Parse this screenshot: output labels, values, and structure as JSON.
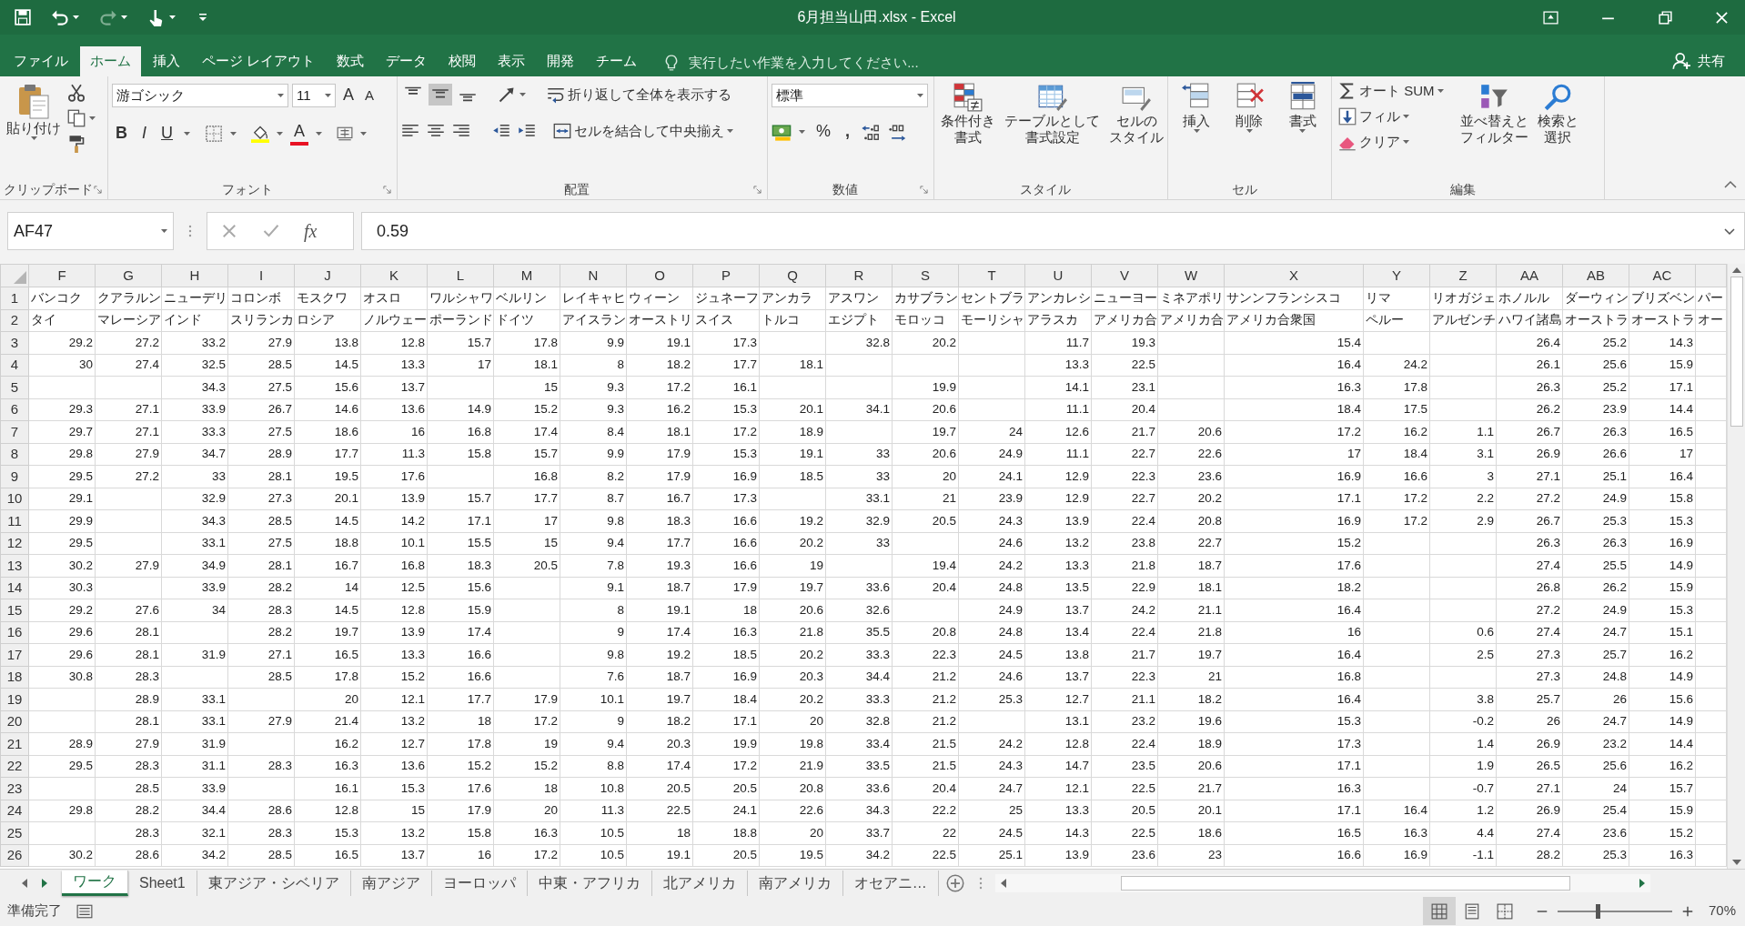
{
  "window": {
    "title": "6月担当山田.xlsx - Excel"
  },
  "ribbon": {
    "tabs": [
      {
        "label": "ファイル",
        "selected": false
      },
      {
        "label": "ホーム",
        "selected": true
      },
      {
        "label": "挿入",
        "selected": false
      },
      {
        "label": "ページ レイアウト",
        "selected": false
      },
      {
        "label": "数式",
        "selected": false
      },
      {
        "label": "データ",
        "selected": false
      },
      {
        "label": "校閲",
        "selected": false
      },
      {
        "label": "表示",
        "selected": false
      },
      {
        "label": "開発",
        "selected": false
      },
      {
        "label": "チーム",
        "selected": false
      }
    ],
    "tell_me": {
      "placeholder": "実行したい作業を入力してください..."
    },
    "share": "共有",
    "clipboard": {
      "paste": "貼り付け",
      "label": "クリップボード"
    },
    "font": {
      "name": "游ゴシック",
      "size": "11",
      "grow": "A",
      "shrink": "A",
      "bold": "B",
      "italic": "I",
      "underline": "U",
      "color_letter": "A",
      "label": "フォント"
    },
    "alignment": {
      "vertical": [
        {
          "selected": false
        },
        {
          "selected": true
        },
        {
          "selected": false
        }
      ],
      "wrap": "折り返して全体を表示する",
      "merge": "セルを結合して中央揃え",
      "label": "配置"
    },
    "number": {
      "format": "標準",
      "percent": "%",
      "comma": ",",
      "label": "数値"
    },
    "styles": {
      "buttons": [
        [
          "条件付き",
          "書式"
        ],
        [
          "テーブルとして",
          "書式設定"
        ],
        [
          "セルの",
          "スタイル"
        ]
      ],
      "label": "スタイル"
    },
    "cells": {
      "buttons": [
        "挿入",
        "削除",
        "書式"
      ],
      "label": "セル"
    },
    "editing": {
      "autosum": "オート SUM",
      "fill": "フィル",
      "clear": "クリア",
      "sort": [
        "並べ替えと",
        "フィルター"
      ],
      "find": [
        "検索と",
        "選択"
      ],
      "label": "編集"
    }
  },
  "formula_bar": {
    "name_box": "AF47",
    "fx": "fx",
    "value": "0.59"
  },
  "sheet": {
    "columns": [
      "F",
      "G",
      "H",
      "I",
      "J",
      "K",
      "L",
      "M",
      "N",
      "O",
      "P",
      "Q",
      "R",
      "S",
      "T",
      "U",
      "V",
      "W",
      "X",
      "Y",
      "Z",
      "AA",
      "AB",
      "AC"
    ],
    "rows": [
      {
        "number": "1",
        "kind": "labels",
        "cells": [
          "バンコク",
          "クアラルン",
          "ニューデリ",
          "コロンボ",
          "モスクワ",
          "オスロ",
          "ワルシャワ",
          "ベルリン",
          "レイキャヒ",
          "ウィーン",
          "ジュネーフ",
          "アンカラ",
          "アスワン",
          "カサブラン",
          "セントブラ",
          "アンカレシ",
          "ニューヨー",
          "ミネアポリ",
          "サンンフランシスコ",
          "リマ",
          "リオガジェ",
          "ホノルル",
          "ダーウィン",
          "ブリズベン",
          "パー"
        ]
      },
      {
        "number": "2",
        "kind": "labels",
        "cells": [
          "タイ",
          "マレーシア",
          "インド",
          "スリランカ",
          "ロシア",
          "ノルウェー",
          "ポーランド",
          "ドイツ",
          "アイスラン",
          "オーストリ",
          "スイス",
          "トルコ",
          "エジプト",
          "モロッコ",
          "モーリシャ",
          "アラスカ",
          "アメリカ合",
          "アメリカ合",
          "アメリカ合衆国",
          "ペルー",
          "アルゼンチ",
          "ハワイ諸島",
          "オーストラ",
          "オーストラ",
          "オー"
        ]
      },
      {
        "number": "3",
        "kind": "values",
        "cells": [
          "29.2",
          "27.2",
          "33.2",
          "27.9",
          "13.8",
          "12.8",
          "15.7",
          "17.8",
          "9.9",
          "19.1",
          "17.3",
          null,
          "32.8",
          "20.2",
          null,
          "11.7",
          "19.3",
          null,
          "15.4",
          null,
          null,
          "26.4",
          "25.2",
          "14.3"
        ]
      },
      {
        "number": "4",
        "kind": "values",
        "cells": [
          "30",
          "27.4",
          "32.5",
          "28.5",
          "14.5",
          "13.3",
          "17",
          "18.1",
          "8",
          "18.2",
          "17.7",
          "18.1",
          null,
          null,
          null,
          "13.3",
          "22.5",
          null,
          "16.4",
          "24.2",
          null,
          "26.1",
          "25.6",
          "15.9"
        ]
      },
      {
        "number": "5",
        "kind": "values",
        "cells": [
          null,
          null,
          "34.3",
          "27.5",
          "15.6",
          "13.7",
          null,
          "15",
          "9.3",
          "17.2",
          "16.1",
          null,
          null,
          "19.9",
          null,
          "14.1",
          "23.1",
          null,
          "16.3",
          "17.8",
          null,
          "26.3",
          "25.2",
          "17.1"
        ]
      },
      {
        "number": "6",
        "kind": "values",
        "cells": [
          "29.3",
          "27.1",
          "33.9",
          "26.7",
          "14.6",
          "13.6",
          "14.9",
          "15.2",
          "9.3",
          "16.2",
          "15.3",
          "20.1",
          "34.1",
          "20.6",
          null,
          "11.1",
          "20.4",
          null,
          "18.4",
          "17.5",
          null,
          "26.2",
          "23.9",
          "14.4"
        ]
      },
      {
        "number": "7",
        "kind": "values",
        "cells": [
          "29.7",
          "27.1",
          "33.3",
          "27.5",
          "18.6",
          "16",
          "16.8",
          "17.4",
          "8.4",
          "18.1",
          "17.2",
          "18.9",
          null,
          "19.7",
          "24",
          "12.6",
          "21.7",
          "20.6",
          "17.2",
          "16.2",
          "1.1",
          "26.7",
          "26.3",
          "16.5"
        ]
      },
      {
        "number": "8",
        "kind": "values",
        "cells": [
          "29.8",
          "27.9",
          "34.7",
          "28.9",
          "17.7",
          "11.3",
          "15.8",
          "15.7",
          "9.9",
          "17.9",
          "15.3",
          "19.1",
          "33",
          "20.6",
          "24.9",
          "11.1",
          "22.7",
          "22.6",
          "17",
          "18.4",
          "3.1",
          "26.9",
          "26.6",
          "17"
        ]
      },
      {
        "number": "9",
        "kind": "values",
        "cells": [
          "29.5",
          "27.2",
          "33",
          "28.1",
          "19.5",
          "17.6",
          null,
          "16.8",
          "8.2",
          "17.9",
          "16.9",
          "18.5",
          "33",
          "20",
          "24.1",
          "12.9",
          "22.3",
          "23.6",
          "16.9",
          "16.6",
          "3",
          "27.1",
          "25.1",
          "16.4"
        ]
      },
      {
        "number": "10",
        "kind": "values",
        "cells": [
          "29.1",
          null,
          "32.9",
          "27.3",
          "20.1",
          "13.9",
          "15.7",
          "17.7",
          "8.7",
          "16.7",
          "17.3",
          null,
          "33.1",
          "21",
          "23.9",
          "12.9",
          "22.7",
          "20.2",
          "17.1",
          "17.2",
          "2.2",
          "27.2",
          "24.9",
          "15.8"
        ]
      },
      {
        "number": "11",
        "kind": "values",
        "cells": [
          "29.9",
          null,
          "34.3",
          "28.5",
          "14.5",
          "14.2",
          "17.1",
          "17",
          "9.8",
          "18.3",
          "16.6",
          "19.2",
          "32.9",
          "20.5",
          "24.3",
          "13.9",
          "22.4",
          "20.8",
          "16.9",
          "17.2",
          "2.9",
          "26.7",
          "25.3",
          "15.3"
        ]
      },
      {
        "number": "12",
        "kind": "values",
        "cells": [
          "29.5",
          null,
          "33.1",
          "27.5",
          "18.8",
          "10.1",
          "15.5",
          "15",
          "9.4",
          "17.7",
          "16.6",
          "20.2",
          "33",
          null,
          "24.6",
          "13.2",
          "23.8",
          "22.7",
          "15.2",
          null,
          null,
          "26.3",
          "26.3",
          "16.9"
        ]
      },
      {
        "number": "13",
        "kind": "values",
        "cells": [
          "30.2",
          "27.9",
          "34.9",
          "28.1",
          "16.7",
          "16.8",
          "18.3",
          "20.5",
          "7.8",
          "19.3",
          "16.6",
          "19",
          null,
          "19.4",
          "24.2",
          "13.3",
          "21.8",
          "18.7",
          "17.6",
          null,
          null,
          "27.4",
          "25.5",
          "14.9"
        ]
      },
      {
        "number": "14",
        "kind": "values",
        "cells": [
          "30.3",
          null,
          "33.9",
          "28.2",
          "14",
          "12.5",
          "15.6",
          null,
          "9.1",
          "18.7",
          "17.9",
          "19.7",
          "33.6",
          "20.4",
          "24.8",
          "13.5",
          "22.9",
          "18.1",
          "18.2",
          null,
          null,
          "26.8",
          "26.2",
          "15.9"
        ]
      },
      {
        "number": "15",
        "kind": "values",
        "cells": [
          "29.2",
          "27.6",
          "34",
          "28.3",
          "14.5",
          "12.8",
          "15.9",
          null,
          "8",
          "19.1",
          "18",
          "20.6",
          "32.6",
          null,
          "24.9",
          "13.7",
          "24.2",
          "21.1",
          "16.4",
          null,
          null,
          "27.2",
          "24.9",
          "15.3"
        ]
      },
      {
        "number": "16",
        "kind": "values",
        "cells": [
          "29.6",
          "28.1",
          null,
          "28.2",
          "19.7",
          "13.9",
          "17.4",
          null,
          "9",
          "17.4",
          "16.3",
          "21.8",
          "35.5",
          "20.8",
          "24.8",
          "13.4",
          "22.4",
          "21.8",
          "16",
          null,
          "0.6",
          "27.4",
          "24.7",
          "15.1"
        ]
      },
      {
        "number": "17",
        "kind": "values",
        "cells": [
          "29.6",
          "28.1",
          "31.9",
          "27.1",
          "16.5",
          "13.3",
          "16.6",
          null,
          "9.8",
          "19.2",
          "18.5",
          "20.2",
          "33.3",
          "22.3",
          "24.5",
          "13.8",
          "21.7",
          "19.7",
          "16.4",
          null,
          "2.5",
          "27.3",
          "25.7",
          "16.2"
        ]
      },
      {
        "number": "18",
        "kind": "values",
        "cells": [
          "30.8",
          "28.3",
          null,
          "28.5",
          "17.8",
          "15.2",
          "16.6",
          null,
          "7.6",
          "18.7",
          "16.9",
          "20.3",
          "34.4",
          "21.2",
          "24.6",
          "13.7",
          "22.3",
          "21",
          "16.8",
          null,
          null,
          "27.3",
          "24.8",
          "14.9"
        ]
      },
      {
        "number": "19",
        "kind": "values",
        "cells": [
          null,
          "28.9",
          "33.1",
          null,
          "20",
          "12.1",
          "17.7",
          "17.9",
          "10.1",
          "19.7",
          "18.4",
          "20.2",
          "33.3",
          "21.2",
          "25.3",
          "12.7",
          "21.1",
          "18.2",
          "16.4",
          null,
          "3.8",
          "25.7",
          "26",
          "15.6"
        ]
      },
      {
        "number": "20",
        "kind": "values",
        "cells": [
          null,
          "28.1",
          "33.1",
          "27.9",
          "21.4",
          "13.2",
          "18",
          "17.2",
          "9",
          "18.2",
          "17.1",
          "20",
          "32.8",
          "21.2",
          null,
          "13.1",
          "23.2",
          "19.6",
          "15.3",
          null,
          "-0.2",
          "26",
          "24.7",
          "14.9"
        ]
      },
      {
        "number": "21",
        "kind": "values",
        "cells": [
          "28.9",
          "27.9",
          "31.9",
          null,
          "16.2",
          "12.7",
          "17.8",
          "19",
          "9.4",
          "20.3",
          "19.9",
          "19.8",
          "33.4",
          "21.5",
          "24.2",
          "12.8",
          "22.4",
          "18.9",
          "17.3",
          null,
          "1.4",
          "26.9",
          "23.2",
          "14.4"
        ]
      },
      {
        "number": "22",
        "kind": "values",
        "cells": [
          "29.5",
          "28.3",
          "31.1",
          "28.3",
          "16.3",
          "13.6",
          "15.2",
          "15.2",
          "8.8",
          "17.4",
          "17.2",
          "21.9",
          "33.5",
          "21.5",
          "24.3",
          "14.7",
          "23.5",
          "20.6",
          "17.1",
          null,
          "1.9",
          "26.5",
          "25.6",
          "16.2"
        ]
      },
      {
        "number": "23",
        "kind": "values",
        "cells": [
          null,
          "28.5",
          "33.9",
          null,
          "16.1",
          "15.3",
          "17.6",
          "18",
          "10.8",
          "20.5",
          "20.5",
          "20.8",
          "33.6",
          "20.4",
          "24.7",
          "12.1",
          "22.5",
          "21.7",
          "16.3",
          null,
          "-0.7",
          "27.1",
          "24",
          "15.7"
        ]
      },
      {
        "number": "24",
        "kind": "values",
        "cells": [
          "29.8",
          "28.2",
          "34.4",
          "28.6",
          "12.8",
          "15",
          "17.9",
          "20",
          "11.3",
          "22.5",
          "24.1",
          "22.6",
          "34.3",
          "22.2",
          "25",
          "13.3",
          "20.5",
          "20.1",
          "17.1",
          "16.4",
          "1.2",
          "26.9",
          "25.4",
          "15.9"
        ]
      },
      {
        "number": "25",
        "kind": "values",
        "cells": [
          null,
          "28.3",
          "32.1",
          "28.3",
          "15.3",
          "13.2",
          "15.8",
          "16.3",
          "10.5",
          "18",
          "18.8",
          "20",
          "33.7",
          "22",
          "24.5",
          "14.3",
          "22.5",
          "18.6",
          "16.5",
          "16.3",
          "4.4",
          "27.4",
          "23.6",
          "15.2"
        ]
      },
      {
        "number": "26",
        "kind": "values",
        "cells": [
          "30.2",
          "28.6",
          "34.2",
          "28.5",
          "16.5",
          "13.7",
          "16",
          "17.2",
          "10.5",
          "19.1",
          "20.5",
          "19.5",
          "34.2",
          "22.5",
          "25.1",
          "13.9",
          "23.6",
          "23",
          "16.6",
          "16.9",
          "-1.1",
          "28.2",
          "25.3",
          "16.3"
        ]
      }
    ]
  },
  "sheet_tabs": [
    {
      "label": "ワーク",
      "selected": true
    },
    {
      "label": "Sheet1",
      "selected": false
    },
    {
      "label": "東アジア・シベリア",
      "selected": false
    },
    {
      "label": "南アジア",
      "selected": false
    },
    {
      "label": "ヨーロッパ",
      "selected": false
    },
    {
      "label": "中東・アフリカ",
      "selected": false
    },
    {
      "label": "北アメリカ",
      "selected": false
    },
    {
      "label": "南アメリカ",
      "selected": false
    },
    {
      "label": "オセアニ…",
      "selected": false
    }
  ],
  "status_bar": {
    "text": "準備完了",
    "views": [
      {
        "selected": true
      },
      {
        "selected": false
      },
      {
        "selected": false
      }
    ],
    "zoom": {
      "level": 0.35,
      "reading": "70%"
    }
  }
}
